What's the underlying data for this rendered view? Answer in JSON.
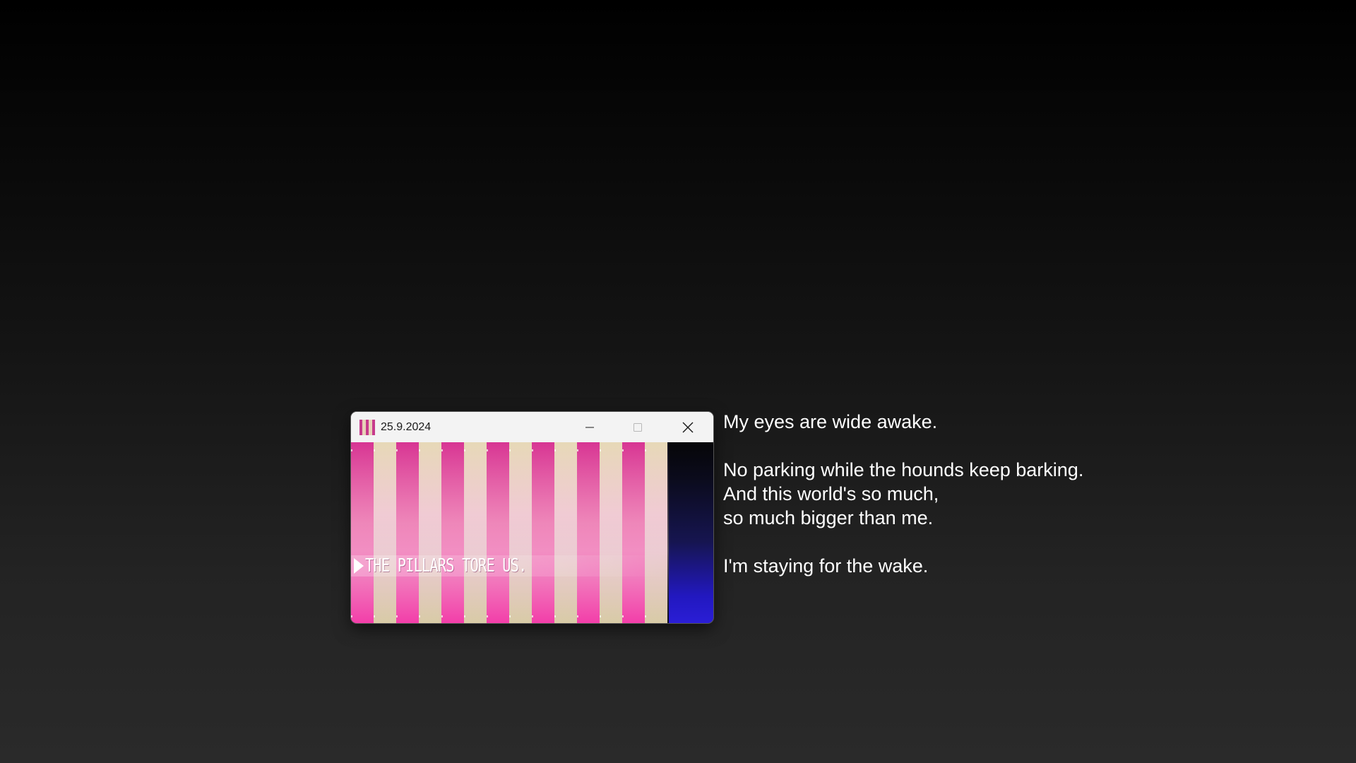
{
  "window": {
    "title": "25.9.2024",
    "icon": "pillars-app-icon",
    "controls": {
      "minimize": "minimize-icon",
      "maximize": "maximize-icon",
      "close": "close-icon"
    }
  },
  "game": {
    "banner_text": "THE PILLARS TORE US.",
    "colors": {
      "pink": "#e23c98",
      "cream": "#e8d6b4",
      "blue": "#2a1ed6"
    }
  },
  "lyrics": {
    "line1": "My eyes are wide awake.",
    "line2": "No parking while the hounds keep barking.",
    "line3": "And this world's so much,",
    "line4": "so much bigger than me.",
    "line5": "I'm staying for the wake."
  }
}
